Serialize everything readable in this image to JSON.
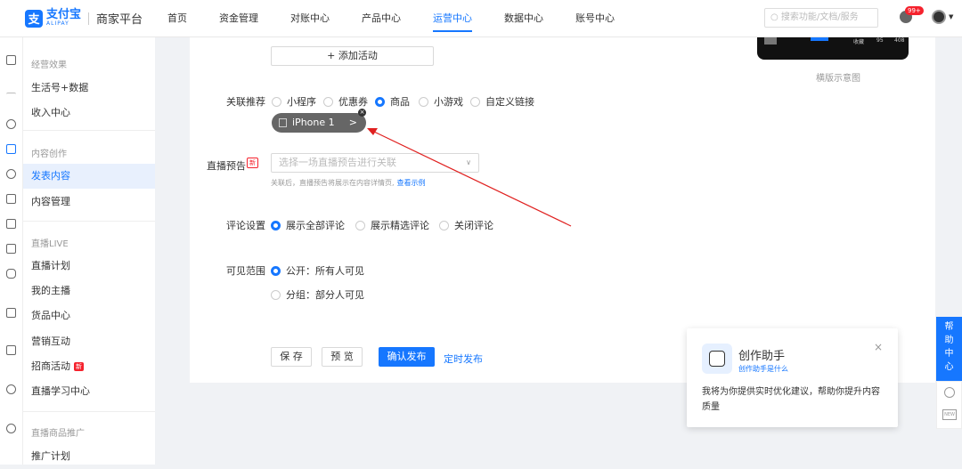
{
  "header": {
    "logo_cn": "支付宝",
    "logo_en": "ALIPAY",
    "platform": "商家平台",
    "nav": [
      "首页",
      "资金管理",
      "对账中心",
      "产品中心",
      "运营中心",
      "数据中心",
      "账号中心"
    ],
    "search_placeholder": "搜索功能/文档/服务",
    "notif_badge": "99+"
  },
  "sidebar": {
    "groups": [
      "经营效果",
      "内容创作",
      "直播LIVE",
      "直播商品推广"
    ],
    "items": [
      "生活号+数据",
      "收入中心",
      "发表内容",
      "内容管理",
      "直播计划",
      "我的主播",
      "货品中心",
      "营销互动",
      "招商活动",
      "直播学习中心",
      "推广计划"
    ],
    "new_tag": "新"
  },
  "form": {
    "add_activity": "+ 添加活动",
    "preview_caption": "横版示意图",
    "related_label": "关联推荐",
    "related_options": [
      "小程序",
      "优惠券",
      "商品",
      "小游戏",
      "自定义链接"
    ],
    "product_chip": "iPhone 1",
    "live_label": "直播预告",
    "live_new": "新",
    "live_placeholder": "选择一场直播预告进行关联",
    "live_hint": "关联后，直播预告将展示在内容详情页,",
    "live_hint_link": "查看示例",
    "comment_label": "评论设置",
    "comment_options": [
      "展示全部评论",
      "展示精选评论",
      "关闭评论"
    ],
    "visible_label": "可见范围",
    "visible_options": [
      "公开：所有人可见",
      "分组：部分人可见"
    ],
    "phone_stats": [
      "收藏",
      "95",
      "408"
    ]
  },
  "actions": {
    "save": "保 存",
    "preview": "预 览",
    "publish": "确认发布",
    "schedule": "定时发布"
  },
  "help": {
    "label": "帮助中心"
  },
  "assistant": {
    "title": "创作助手",
    "link": "创作助手是什么",
    "body": "我将为你提供实时优化建议，帮助你提升内容质量"
  },
  "colors": {
    "accent": "#1677ff",
    "danger": "#f5222d",
    "arrow": "#e0201f"
  }
}
